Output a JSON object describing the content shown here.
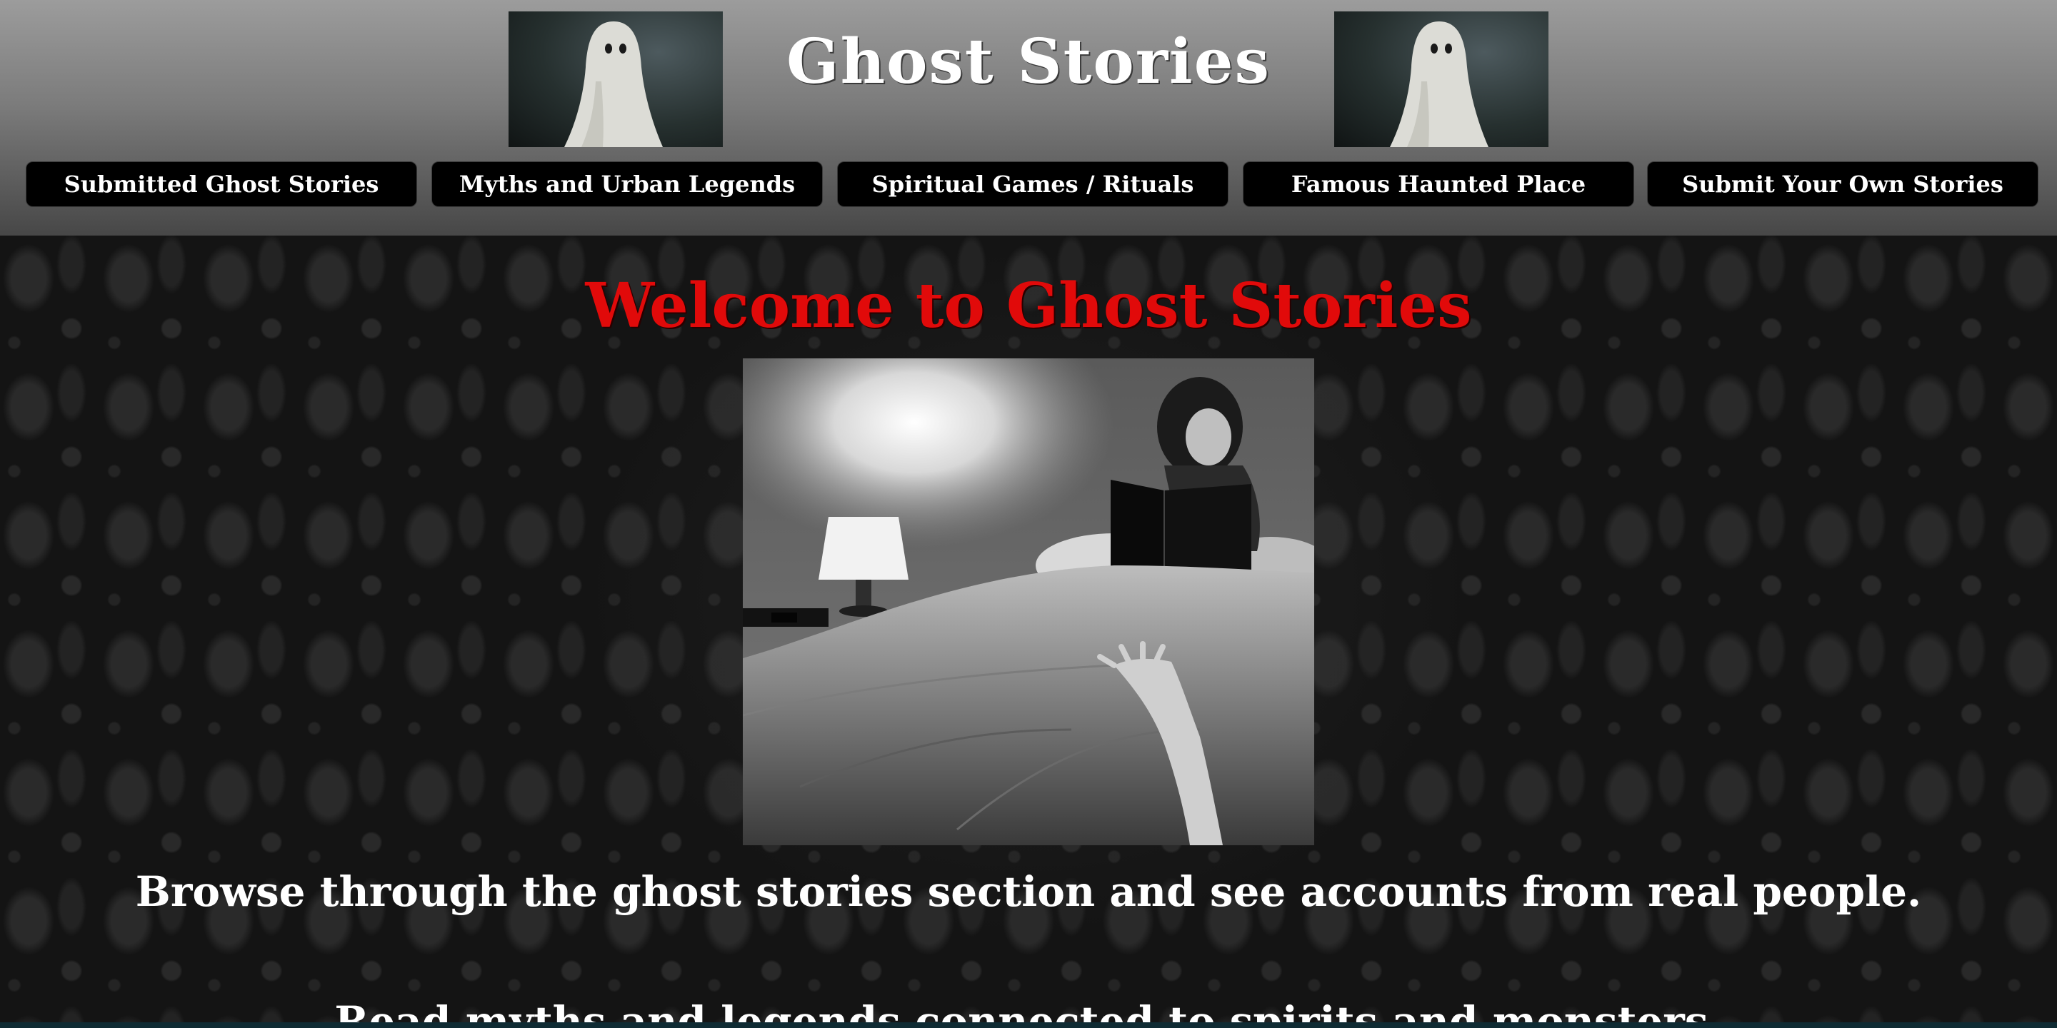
{
  "header": {
    "title": "Ghost Stories",
    "images": [
      {
        "icon": "ghost-sheet-photo"
      },
      {
        "icon": "ghost-sheet-photo"
      }
    ]
  },
  "nav": {
    "items": [
      {
        "label": "Submitted Ghost Stories"
      },
      {
        "label": "Myths and Urban Legends"
      },
      {
        "label": "Spiritual Games / Rituals"
      },
      {
        "label": "Famous Haunted Place"
      },
      {
        "label": "Submit Your Own Stories"
      }
    ]
  },
  "main": {
    "welcome": "Welcome to Ghost Stories",
    "hero_image": {
      "icon": "girl-reading-in-bed-photo"
    },
    "paragraphs": [
      "Browse through the ghost stories section and see accounts from real people.",
      "Read myths and legends connected to spirits and monsters."
    ]
  },
  "colors": {
    "header_top": "#9c9c9c",
    "header_bottom": "#474747",
    "nav_button": "#000000",
    "welcome_text": "#e10a0a",
    "body_text": "#ffffff",
    "page_background": "#141414"
  }
}
